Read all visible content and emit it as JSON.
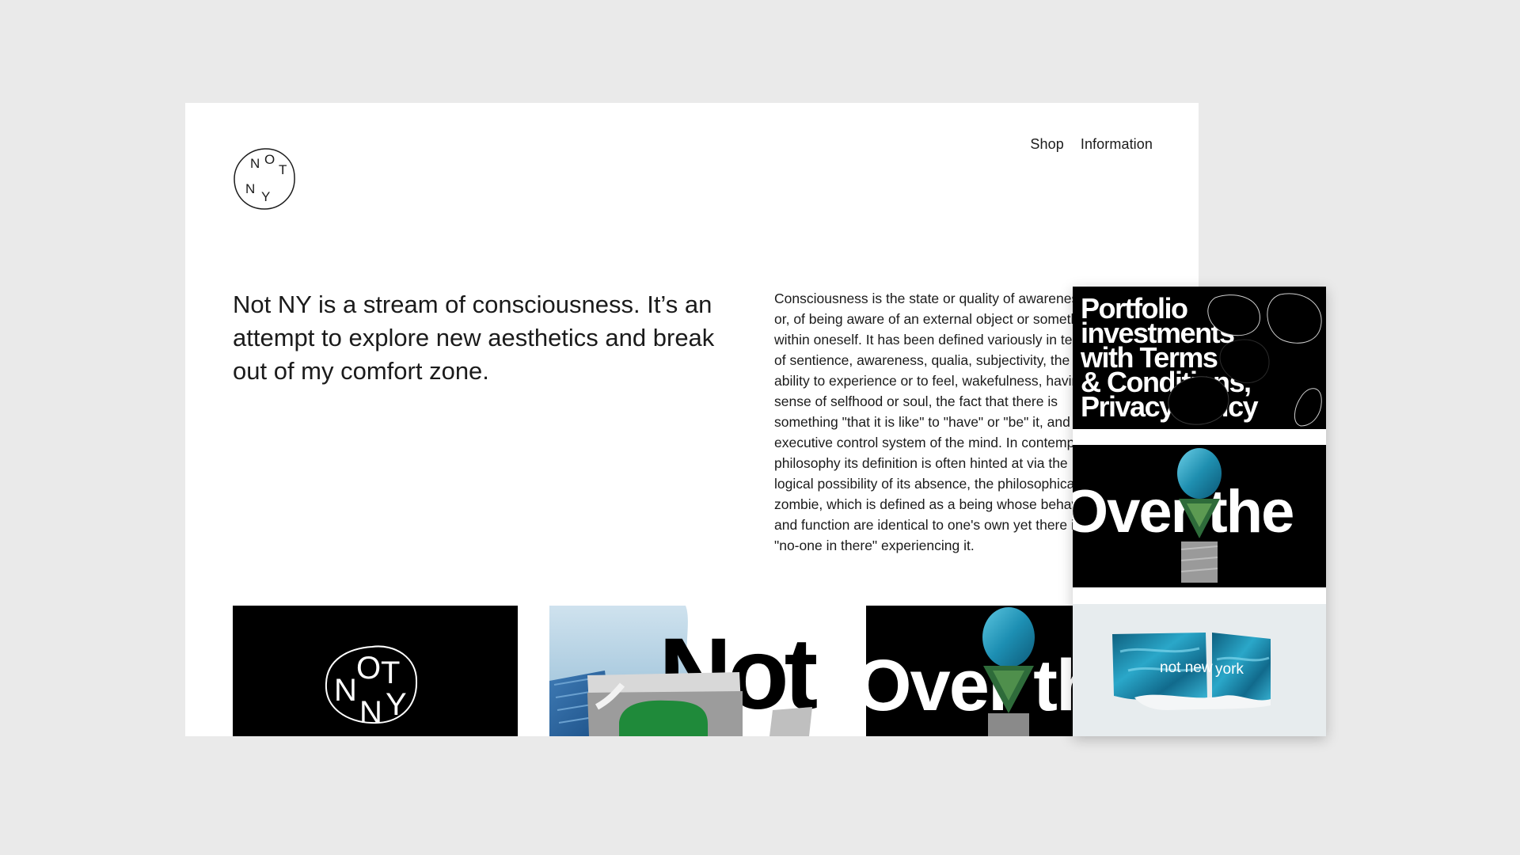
{
  "brand": {
    "logo_letters": [
      "N",
      "O",
      "T",
      "N",
      "Y"
    ]
  },
  "nav": {
    "items": [
      {
        "label": "Shop"
      },
      {
        "label": "Information"
      }
    ]
  },
  "intro": {
    "headline": "Not NY is a stream of consciousness. It’s an attempt to explore new aesthetics and break out of my comfort zone.",
    "body": "Consciousness is the state or quality of awareness, or, of being aware of an external object or something within oneself. It has been defined variously in terms of sentience, awareness, qualia, subjectivity, the ability to experience or to feel, wakefulness, having a sense of selfhood or soul, the fact that there is something \"that it is like\" to \"have\" or \"be\" it, and the executive control system of the mind. In contemporary philosophy its definition is often hinted at via the logical possibility of its absence, the philosophical zombie, which is defined as a being whose behavior and function are identical to one's own yet there is \"no-one in there\" experiencing it."
  },
  "thumbnails": [
    {
      "letters": [
        "N",
        "O",
        "T",
        "N",
        "Y"
      ]
    },
    {
      "word": "Not"
    },
    {
      "word": "Over the"
    }
  ],
  "panel": {
    "cards": [
      {
        "lines": [
          "Portfolio",
          "investments",
          "with Terms",
          "& Conditions,",
          "Privacy Policy"
        ]
      },
      {
        "word": "Over the"
      },
      {
        "word_left": "not new",
        "word_right": "york"
      }
    ]
  },
  "colors": {
    "page_background": "#eaeaea",
    "card_black": "#000000",
    "accent_teal": "#1f8fb0",
    "text": "#1b1b1b"
  }
}
